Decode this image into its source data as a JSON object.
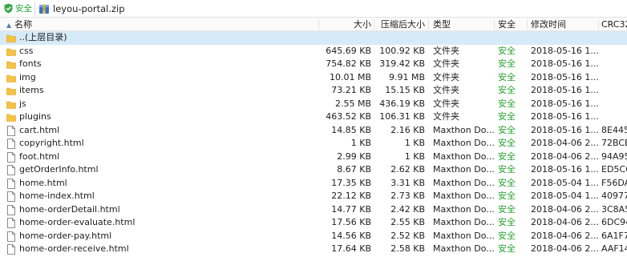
{
  "pathbar": {
    "safe_label": "安全",
    "archive_name": "leyou-portal.zip"
  },
  "columns": {
    "name": "名称",
    "size": "大小",
    "packed": "压缩后大小",
    "type": "类型",
    "safe": "安全",
    "mtime": "修改时间",
    "crc": "CRC32"
  },
  "rows": [
    {
      "kind": "parent",
      "name": "..(上层目录)",
      "size": "",
      "packed": "",
      "type": "",
      "safe": "",
      "mtime": "",
      "crc": ""
    },
    {
      "kind": "folder",
      "name": "css",
      "size": "645.69 KB",
      "packed": "100.92 KB",
      "type": "文件夹",
      "safe": "安全",
      "mtime": "2018-05-16 1...",
      "crc": ""
    },
    {
      "kind": "folder",
      "name": "fonts",
      "size": "754.82 KB",
      "packed": "319.42 KB",
      "type": "文件夹",
      "safe": "安全",
      "mtime": "2018-05-16 1...",
      "crc": ""
    },
    {
      "kind": "folder",
      "name": "img",
      "size": "10.01 MB",
      "packed": "9.91 MB",
      "type": "文件夹",
      "safe": "安全",
      "mtime": "2018-05-16 1...",
      "crc": ""
    },
    {
      "kind": "folder",
      "name": "items",
      "size": "73.21 KB",
      "packed": "15.15 KB",
      "type": "文件夹",
      "safe": "安全",
      "mtime": "2018-05-16 1...",
      "crc": ""
    },
    {
      "kind": "folder",
      "name": "js",
      "size": "2.55 MB",
      "packed": "436.19 KB",
      "type": "文件夹",
      "safe": "安全",
      "mtime": "2018-05-16 1...",
      "crc": ""
    },
    {
      "kind": "folder",
      "name": "plugins",
      "size": "463.52 KB",
      "packed": "106.31 KB",
      "type": "文件夹",
      "safe": "安全",
      "mtime": "2018-05-16 1...",
      "crc": ""
    },
    {
      "kind": "file",
      "name": "cart.html",
      "size": "14.85 KB",
      "packed": "2.16 KB",
      "type": "Maxthon Do...",
      "safe": "安全",
      "mtime": "2018-05-16 1...",
      "crc": "8E445"
    },
    {
      "kind": "file",
      "name": "copyright.html",
      "size": "1 KB",
      "packed": "1 KB",
      "type": "Maxthon Do...",
      "safe": "安全",
      "mtime": "2018-04-06 2...",
      "crc": "72BCE"
    },
    {
      "kind": "file",
      "name": "foot.html",
      "size": "2.99 KB",
      "packed": "1 KB",
      "type": "Maxthon Do...",
      "safe": "安全",
      "mtime": "2018-04-06 2...",
      "crc": "94A95"
    },
    {
      "kind": "file",
      "name": "getOrderInfo.html",
      "size": "8.67 KB",
      "packed": "2.62 KB",
      "type": "Maxthon Do...",
      "safe": "安全",
      "mtime": "2018-05-16 1...",
      "crc": "ED5C6"
    },
    {
      "kind": "file",
      "name": "home.html",
      "size": "17.35 KB",
      "packed": "3.31 KB",
      "type": "Maxthon Do...",
      "safe": "安全",
      "mtime": "2018-05-04 1...",
      "crc": "F56DA"
    },
    {
      "kind": "file",
      "name": "home-index.html",
      "size": "22.12 KB",
      "packed": "2.73 KB",
      "type": "Maxthon Do...",
      "safe": "安全",
      "mtime": "2018-05-04 1...",
      "crc": "40977"
    },
    {
      "kind": "file",
      "name": "home-orderDetail.html",
      "size": "14.77 KB",
      "packed": "2.42 KB",
      "type": "Maxthon Do...",
      "safe": "安全",
      "mtime": "2018-04-06 2...",
      "crc": "3C8A5"
    },
    {
      "kind": "file",
      "name": "home-order-evaluate.html",
      "size": "17.56 KB",
      "packed": "2.55 KB",
      "type": "Maxthon Do...",
      "safe": "安全",
      "mtime": "2018-04-06 2...",
      "crc": "6DC94"
    },
    {
      "kind": "file",
      "name": "home-order-pay.html",
      "size": "14.56 KB",
      "packed": "2.52 KB",
      "type": "Maxthon Do...",
      "safe": "安全",
      "mtime": "2018-04-06 2...",
      "crc": "6A1F7"
    },
    {
      "kind": "file",
      "name": "home-order-receive.html",
      "size": "17.64 KB",
      "packed": "2.58 KB",
      "type": "Maxthon Do...",
      "safe": "安全",
      "mtime": "2018-04-06 2...",
      "crc": "AAF14"
    }
  ],
  "icons": {
    "shield": "shield-check-icon",
    "archive": "zip-archive-icon",
    "folder": "folder-icon",
    "file": "file-icon",
    "sort": "sort-ascending-icon"
  },
  "colors": {
    "safe_green": "#27a22e",
    "folder_yellow": "#f5c342",
    "parent_row_bg": "#d7eaf8"
  }
}
